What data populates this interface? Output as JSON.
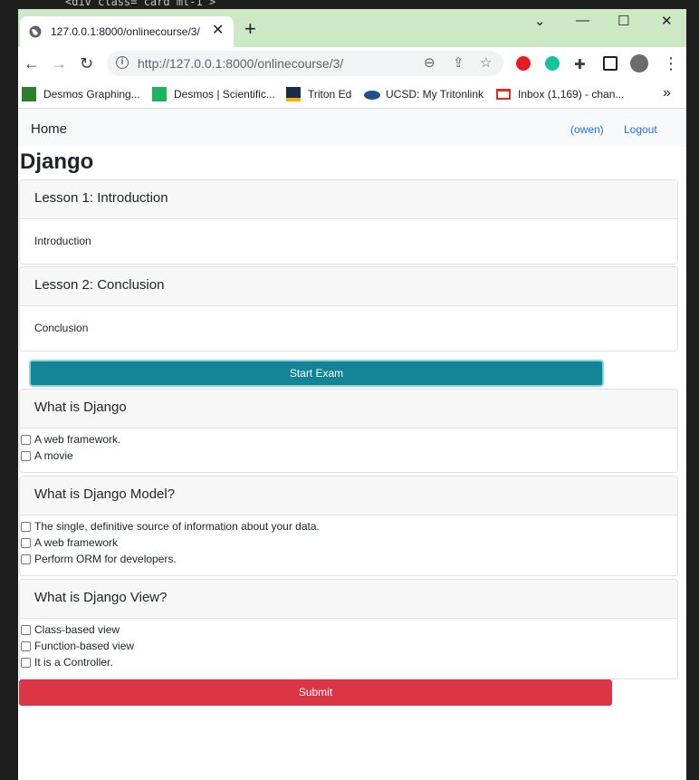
{
  "editor": {
    "top_code": "<div class= card mt-1 >"
  },
  "browser": {
    "tab_title": "127.0.0.1:8000/onlinecourse/3/",
    "new_tab": "+",
    "window_controls": [
      "⌄",
      "—",
      "☐",
      "✕"
    ],
    "url": "http://127.0.0.1:8000/onlinecourse/3/",
    "bookmarks": [
      {
        "label": "Desmos Graphing...",
        "icon": "desmos-graphing-icon"
      },
      {
        "label": "Desmos | Scientific...",
        "icon": "desmos-scientific-icon"
      },
      {
        "label": "Triton Ed",
        "icon": "triton-ed-icon"
      },
      {
        "label": "UCSD: My Tritonlink",
        "icon": "ucsd-icon"
      },
      {
        "label": "Inbox (1,169) - chan...",
        "icon": "gmail-icon"
      }
    ],
    "bookmarks_more": "»",
    "colors": {
      "tabbar": "#cce8c4"
    }
  },
  "page": {
    "nav": {
      "home": "Home",
      "user": "(owen)",
      "logout": "Logout"
    },
    "course_title": "Django",
    "lessons": [
      {
        "title": "Lesson 1: Introduction",
        "content": "Introduction"
      },
      {
        "title": "Lesson 2: Conclusion",
        "content": "Conclusion"
      }
    ],
    "start_exam": "Start Exam",
    "questions": [
      {
        "text": "What is Django",
        "choices": [
          "A web framework.",
          "A movie"
        ]
      },
      {
        "text": "What is Django Model?",
        "choices": [
          "The single, definitive source of information about your data.",
          "A web framework",
          "Perform ORM for developers."
        ]
      },
      {
        "text": "What is Django View?",
        "choices": [
          "Class-based view",
          "Function-based view",
          "It is a Controller."
        ]
      }
    ],
    "submit": "Submit",
    "colors": {
      "info": "#138496",
      "danger": "#dc3545"
    }
  }
}
